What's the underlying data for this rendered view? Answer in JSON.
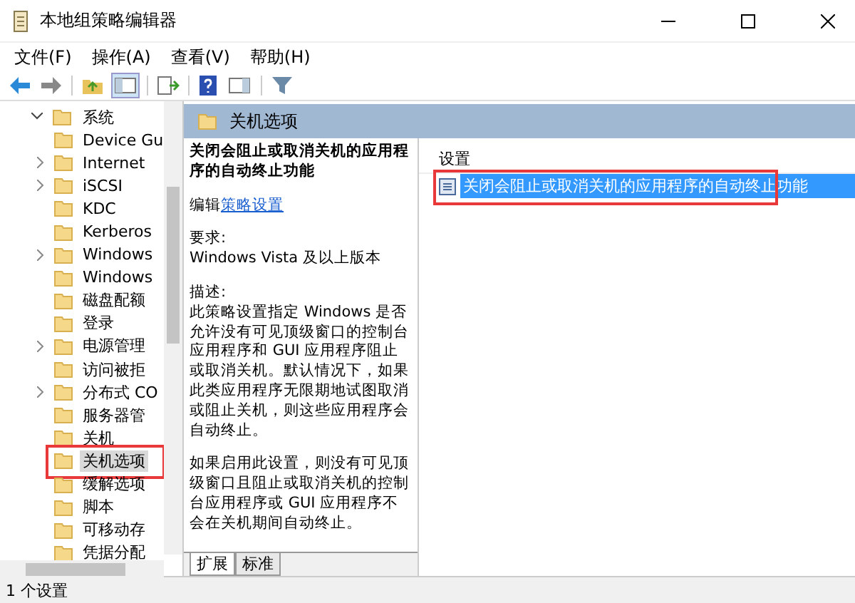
{
  "window": {
    "title": "本地组策略编辑器"
  },
  "menu": [
    "文件(F)",
    "操作(A)",
    "查看(V)",
    "帮助(H)"
  ],
  "tree": {
    "label": "系统",
    "expanded": true,
    "children": [
      {
        "label": "Device Gu",
        "has_children": false,
        "selected": false
      },
      {
        "label": "Internet",
        "has_children": true,
        "selected": false
      },
      {
        "label": "iSCSI",
        "has_children": true,
        "selected": false
      },
      {
        "label": "KDC",
        "has_children": false,
        "selected": false
      },
      {
        "label": "Kerberos",
        "has_children": false,
        "selected": false
      },
      {
        "label": "Windows",
        "has_children": true,
        "selected": false
      },
      {
        "label": "Windows",
        "has_children": false,
        "selected": false
      },
      {
        "label": "磁盘配额",
        "has_children": false,
        "selected": false
      },
      {
        "label": "登录",
        "has_children": false,
        "selected": false
      },
      {
        "label": "电源管理",
        "has_children": true,
        "selected": false
      },
      {
        "label": "访问被拒",
        "has_children": false,
        "selected": false
      },
      {
        "label": "分布式 CO",
        "has_children": true,
        "selected": false
      },
      {
        "label": "服务器管",
        "has_children": false,
        "selected": false
      },
      {
        "label": "关机",
        "has_children": false,
        "selected": false
      },
      {
        "label": "关机选项",
        "has_children": false,
        "selected": true
      },
      {
        "label": "缓解选项",
        "has_children": false,
        "selected": false
      },
      {
        "label": "脚本",
        "has_children": false,
        "selected": false
      },
      {
        "label": "可移动存",
        "has_children": false,
        "selected": false
      },
      {
        "label": "凭据分配",
        "has_children": false,
        "selected": false
      }
    ]
  },
  "header": {
    "title": "关机选项"
  },
  "description": {
    "title": "关闭会阻止或取消关机的应用程序的自动终止功能",
    "edit_prefix": "编辑",
    "edit_link": "策略设置",
    "requirements_label": "要求:",
    "requirements": "Windows Vista 及以上版本",
    "description_label": "描述:",
    "paragraphs": [
      "此策略设置指定 Windows 是否允许没有可见顶级窗口的控制台应用程序和 GUI 应用程序阻止或取消关机。默认情况下，如果此类应用程序无限期地试图取消或阻止关机，则这些应用程序会自动终止。",
      "如果启用此设置，则没有可见顶级窗口且阻止或取消关机的控制台应用程序或 GUI 应用程序不会在关机期间自动终止。"
    ]
  },
  "tabs": [
    {
      "label": "扩展",
      "selected": true
    },
    {
      "label": "标准",
      "selected": false
    }
  ],
  "settings": {
    "column": "设置",
    "rows": [
      {
        "label": "关闭会阻止或取消关机的应用程序的自动终止功能",
        "selected": true
      }
    ]
  },
  "status_bar": "1 个设置"
}
